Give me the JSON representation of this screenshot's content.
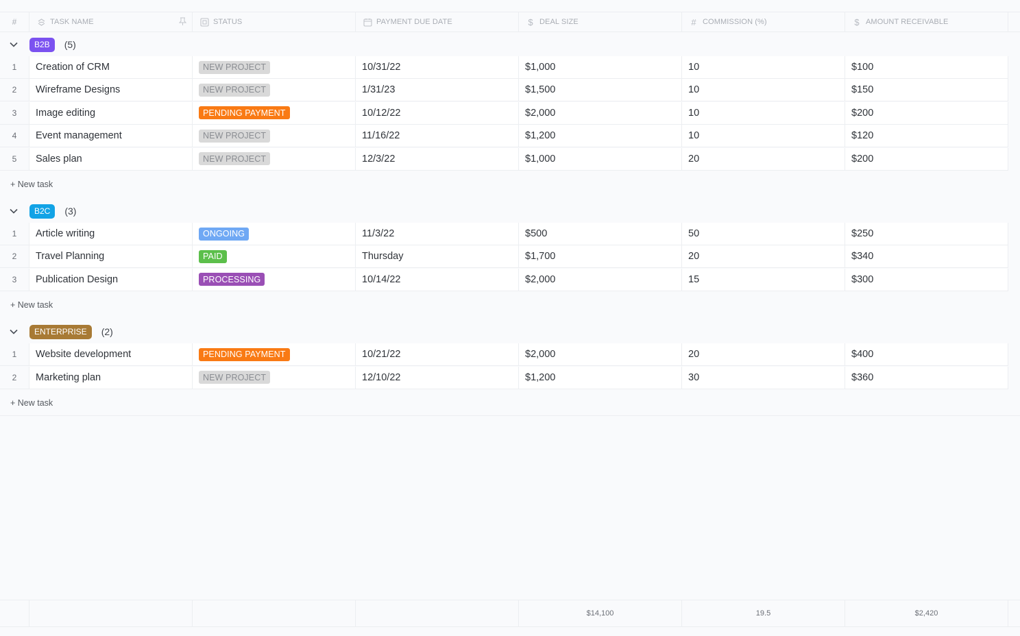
{
  "columns": {
    "num": "#",
    "task_name": "TASK NAME",
    "status": "STATUS",
    "payment_due_date": "PAYMENT DUE DATE",
    "deal_size": "DEAL SIZE",
    "commission": "COMMISSION (%)",
    "amount_receivable": "AMOUNT RECEIVABLE"
  },
  "icons": {
    "task_name": "sort-stack-icon",
    "status": "status-square-icon",
    "payment_due_date": "calendar-icon",
    "deal_size": "dollar-icon",
    "commission": "hash-icon",
    "amount_receivable": "dollar-icon",
    "pin": "pin-icon",
    "chevron": "chevron-down-icon"
  },
  "status_colors": {
    "NEW PROJECT": {
      "bg": "#d9d9d9",
      "fg": "#8a8d92"
    },
    "PENDING PAYMENT": {
      "bg": "#f97a14",
      "fg": "#ffffff"
    },
    "ONGOING": {
      "bg": "#6fa8f4",
      "fg": "#ffffff"
    },
    "PAID": {
      "bg": "#5cbf4b",
      "fg": "#ffffff"
    },
    "PROCESSING": {
      "bg": "#9a4fb5",
      "fg": "#ffffff"
    }
  },
  "groups": [
    {
      "label": "B2B",
      "count": "(5)",
      "color": "#7b52f0",
      "new_task_label": "+ New task",
      "rows": [
        {
          "num": "1",
          "task": "Creation of CRM",
          "status": "NEW PROJECT",
          "due": "10/31/22",
          "deal": "$1,000",
          "commission": "10",
          "amount": "$100"
        },
        {
          "num": "2",
          "task": "Wireframe Designs",
          "status": "NEW PROJECT",
          "due": "1/31/23",
          "deal": "$1,500",
          "commission": "10",
          "amount": "$150"
        },
        {
          "num": "3",
          "task": "Image editing",
          "status": "PENDING PAYMENT",
          "due": "10/12/22",
          "deal": "$2,000",
          "commission": "10",
          "amount": "$200"
        },
        {
          "num": "4",
          "task": "Event management",
          "status": "NEW PROJECT",
          "due": "11/16/22",
          "deal": "$1,200",
          "commission": "10",
          "amount": "$120"
        },
        {
          "num": "5",
          "task": "Sales plan",
          "status": "NEW PROJECT",
          "due": "12/3/22",
          "deal": "$1,000",
          "commission": "20",
          "amount": "$200"
        }
      ]
    },
    {
      "label": "B2C",
      "count": "(3)",
      "color": "#12a3e6",
      "new_task_label": "+ New task",
      "rows": [
        {
          "num": "1",
          "task": "Article writing",
          "status": "ONGOING",
          "due": "11/3/22",
          "deal": "$500",
          "commission": "50",
          "amount": "$250"
        },
        {
          "num": "2",
          "task": "Travel Planning",
          "status": "PAID",
          "due": "Thursday",
          "deal": "$1,700",
          "commission": "20",
          "amount": "$340"
        },
        {
          "num": "3",
          "task": "Publication Design",
          "status": "PROCESSING",
          "due": "10/14/22",
          "deal": "$2,000",
          "commission": "15",
          "amount": "$300"
        }
      ]
    },
    {
      "label": "ENTERPRISE",
      "count": "(2)",
      "color": "#a87a35",
      "new_task_label": "+ New task",
      "rows": [
        {
          "num": "1",
          "task": "Website development",
          "status": "PENDING PAYMENT",
          "due": "10/21/22",
          "deal": "$2,000",
          "commission": "20",
          "amount": "$400"
        },
        {
          "num": "2",
          "task": "Marketing plan",
          "status": "NEW PROJECT",
          "due": "12/10/22",
          "deal": "$1,200",
          "commission": "30",
          "amount": "$360"
        }
      ]
    }
  ],
  "totals": {
    "deal_size": "$14,100",
    "commission": "19.5",
    "amount_receivable": "$2,420"
  }
}
